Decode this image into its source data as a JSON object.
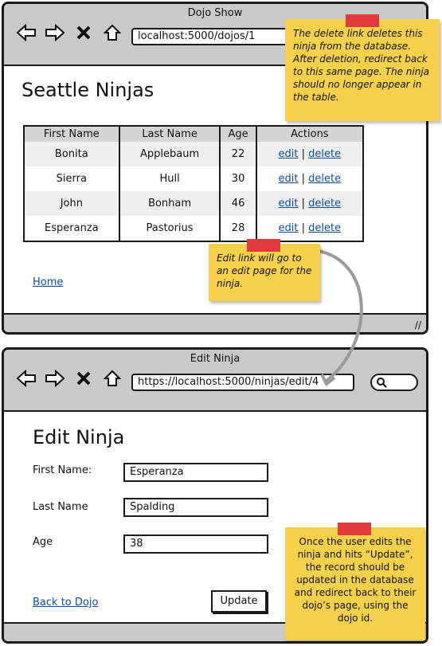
{
  "window1": {
    "title": "Dojo Show",
    "url": "localhost:5000/dojos/1",
    "heading": "Seattle Ninjas",
    "table": {
      "headers": [
        "First Name",
        "Last Name",
        "Age",
        "Actions"
      ],
      "rows": [
        {
          "first": "Bonita",
          "last": "Applebaum",
          "age": "22"
        },
        {
          "first": "Sierra",
          "last": "Hull",
          "age": "30"
        },
        {
          "first": "John",
          "last": "Bonham",
          "age": "46"
        },
        {
          "first": "Esperanza",
          "last": "Pastorius",
          "age": "28"
        }
      ],
      "edit_label": "edit",
      "separator": "|",
      "delete_label": "delete"
    },
    "home_link": "Home"
  },
  "window2": {
    "title": "Edit Ninja",
    "url": "https://localhost:5000/ninjas/edit/4",
    "heading": "Edit Ninja",
    "fields": {
      "first_label": "First Name:",
      "first_value": "Esperanza",
      "last_label": "Last Name",
      "last_value": "Spalding",
      "age_label": "Age",
      "age_value": "38"
    },
    "back_link": "Back to Dojo",
    "update_button": "Update"
  },
  "notes": {
    "delete_note": "The delete link deletes this ninja from the database. After deletion, redirect back to this same page. The ninja should no longer appear in the table.",
    "edit_note": "Edit link will go to an edit page for the ninja.",
    "update_note": "Once the user edits the ninja and hits “Update”, the record should be updated in the database and redirect back to their dojo’s page, using the dojo id."
  },
  "colors": {
    "note": "#f5d04a",
    "tape": "#e03a3a",
    "link": "#0b4d9c",
    "chrome": "#c9c9c9"
  },
  "icons": [
    "back-arrow-icon",
    "forward-arrow-icon",
    "close-x-icon",
    "home-icon",
    "search-icon",
    "resize-grip-icon"
  ]
}
